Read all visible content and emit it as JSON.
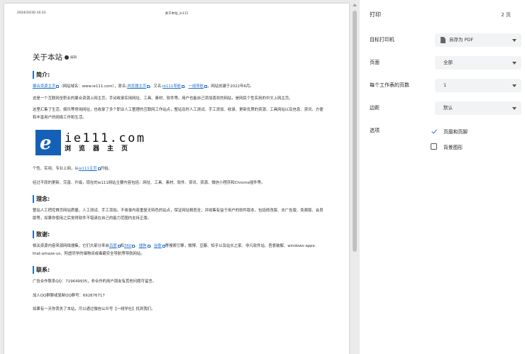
{
  "preview": {
    "header_date": "2024/10/30 16:33",
    "header_title": "关于本站_ie111",
    "page_title": "关于本站",
    "edit_label": "编辑",
    "intro_heading": "简介:",
    "intro_p1": {
      "link1": "聚合资源主页",
      "t1": "（网站域名：www.ie111.com），原名:",
      "link2": "浏览器主页",
      "t2": "，又名:",
      "link3": "ie111导航",
      "t3": "、",
      "link4": "一线导航",
      "t4": "，网站创建于2022年6月。"
    },
    "intro_p2": "这是一个互联网全职业的聚合资源上网主页，手动收录实用网址、工具、素材、软件等。用户也能自己添加喜欢的网站，是网民个性实用的中文上网主页。",
    "intro_p3": "这里汇集了生活、娱乐等常用网址，也收录了多个职业人工整理的互联网工作站点，整站及时人工测试、手工添加、收录、更新优质的资源、工具网站以及信息、资讯、方便和丰富用户的网络工作和生活。",
    "logo_domain": "ie111.com",
    "logo_sub": "浏览器主页",
    "slogan_pre": "个性、实用、专业上网，从",
    "slogan_link": "ie111主页",
    "slogan_post": "开始。",
    "features": "经过不段的更新、完善、升级，现在的ie111网站主要内容包括：网址、工具、素材、软件、资讯、资源、微信小程序和Chrome插件等。",
    "concept_heading": "理念:",
    "concept_p": "整站人工把控首页网站质量，人工测试、手工添加。不收录内容重复无特色的站点，保证网址精而全；并收集有益于用户的软件版本，包括修改版、去广告版、免费版、会员版等，如果你使用之后觉得软件不错请在自己的能力范围内支持正版。",
    "thanks_heading": "致谢:",
    "thanks_p": {
      "t1": "相关资源内容来源网络搜集，它们大部分来自",
      "link1": "百度",
      "t2": "和",
      "link2": "360",
      "t3": "、",
      "link3": "搜狗",
      "t4": "、",
      "link4": "谷歌",
      "t5": "等搜索引擎，微博、豆瓣、知乎以及站长之家、非凡软件站、吾爱破解、windows-apps-that-amaze-us、阿虚同学的储物间或毒霸安全导航等导航网站。"
    },
    "contact_heading": "联系:",
    "contact_p1": "广告合作联系QQ：719649935，非合作的用户朋友有其他问题可留言。",
    "contact_p2": "加入QQ群聊或复制QQ群号：692876717",
    "contact_p3": "如果有一天你丢失了本站，可以通过微信公众号【一线学社】找到我们。"
  },
  "settings": {
    "title": "打印",
    "page_count": "2 页",
    "destination_label": "目标打印机",
    "destination_value": "另存为 PDF",
    "pages_label": "页面",
    "pages_value": "全部",
    "per_sheet_label": "每个工作表的页数",
    "per_sheet_value": "1",
    "margins_label": "边距",
    "margins_value": "默认",
    "options_label": "选项",
    "opt_headers": "页眉和页脚",
    "opt_headers_checked": true,
    "opt_background": "背景图形",
    "opt_background_checked": false
  },
  "colors": {
    "accent": "#1a73e8",
    "link": "#1e6fd0",
    "logo_blue": "#1560b7"
  },
  "icons": [
    "printer-icon",
    "edit-icon",
    "external-link-icon",
    "chevron-down-icon",
    "checkbox-icon"
  ]
}
